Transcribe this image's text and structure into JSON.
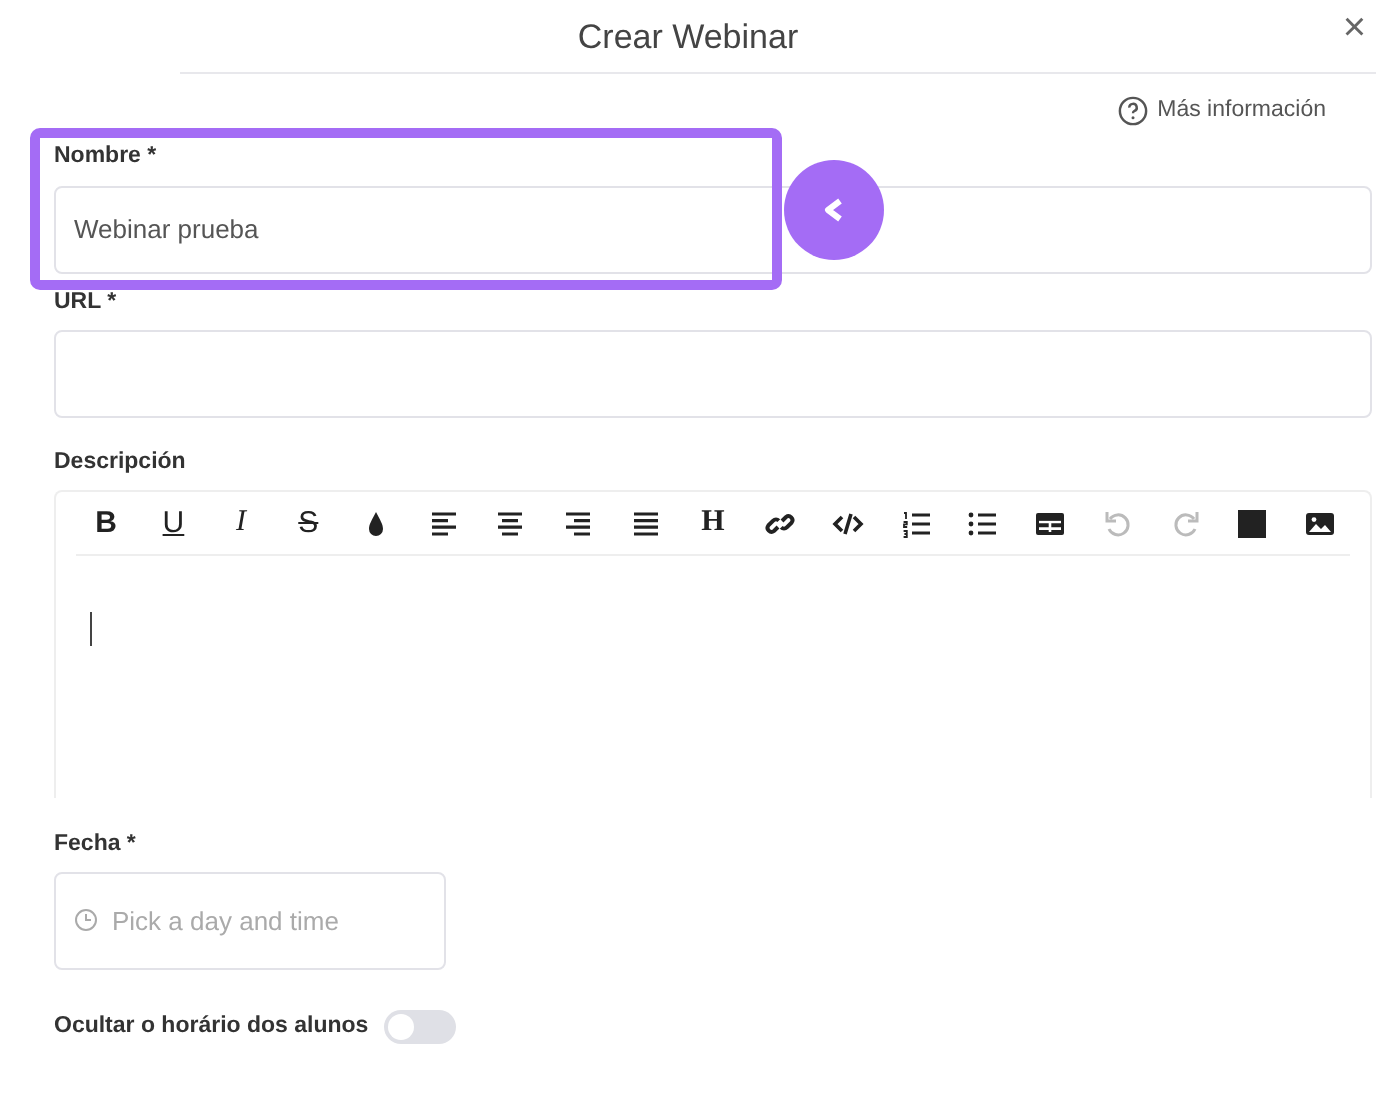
{
  "dialog": {
    "title": "Crear Webinar",
    "close": "×"
  },
  "help_link": "Más información",
  "fields": [
    {
      "label": "Nombre *",
      "value": "Webinar prueba",
      "highlighted": true
    },
    {
      "label": "URL *",
      "highlighted": false
    }
  ],
  "description": {
    "label": "Descripción",
    "toolbar": [
      {
        "kind": "bold",
        "glyph": "B",
        "disabled": false
      },
      {
        "kind": "underline",
        "glyph": "U",
        "disabled": false
      },
      {
        "kind": "italic",
        "glyph": "I",
        "disabled": false
      },
      {
        "kind": "strike",
        "glyph": "S",
        "disabled": false
      },
      {
        "kind": "color",
        "disabled": false
      },
      {
        "kind": "align-left",
        "disabled": false
      },
      {
        "kind": "align-center",
        "disabled": false
      },
      {
        "kind": "align-right",
        "disabled": false
      },
      {
        "kind": "justify",
        "disabled": false
      },
      {
        "kind": "heading",
        "glyph": "H",
        "disabled": false
      },
      {
        "kind": "link",
        "disabled": false
      },
      {
        "kind": "code",
        "disabled": false
      },
      {
        "kind": "ordered-list",
        "disabled": false
      },
      {
        "kind": "bullet-list",
        "disabled": false
      },
      {
        "kind": "table",
        "disabled": false
      },
      {
        "kind": "undo",
        "disabled": true
      },
      {
        "kind": "redo",
        "disabled": true
      },
      {
        "kind": "block",
        "disabled": false
      },
      {
        "kind": "image",
        "disabled": false
      }
    ]
  },
  "date": {
    "label": "Fecha *",
    "placeholder": "Pick a day and time"
  },
  "toggle": {
    "label": "Ocultar o horário dos alunos",
    "on": false
  }
}
